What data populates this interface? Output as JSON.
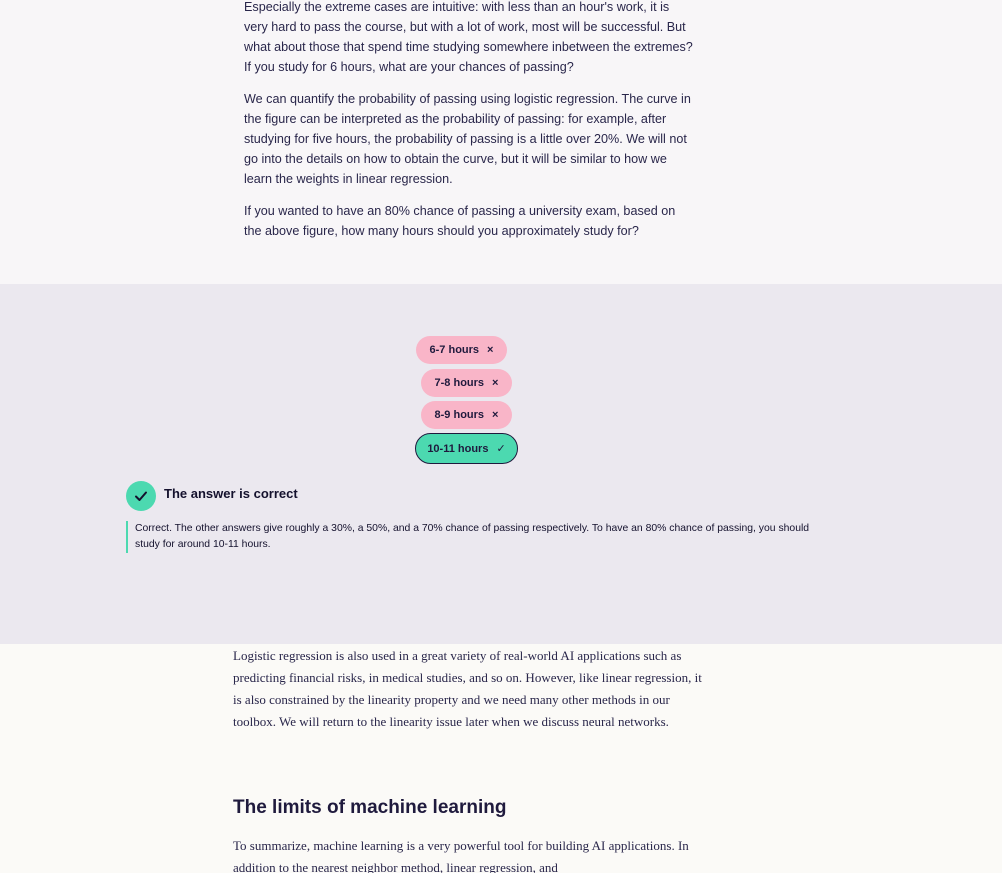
{
  "intro": {
    "paragraphs": [
      "Especially the extreme cases are intuitive: with less than an hour's work, it is very hard to pass the course, but with a lot of work, most will be successful. But what about those that spend time studying somewhere inbetween the extremes? If you study for 6 hours, what are your chances of passing?",
      "We can quantify the probability of passing using logistic regression. The curve in the figure can be interpreted as the probability of passing: for example, after studying for five hours, the probability of passing is a little over 20%. We will not go into the details on how to obtain the curve, but it will be similar to how we learn the weights in linear regression.",
      "If you wanted to have an 80% chance of passing a university exam, based on the above figure, how many hours should you approximately study for?"
    ]
  },
  "quiz": {
    "options": [
      {
        "label": "6-7 hours",
        "status": "wrong",
        "mark": "×"
      },
      {
        "label": "7-8 hours",
        "status": "wrong",
        "mark": "×"
      },
      {
        "label": "8-9 hours",
        "status": "wrong",
        "mark": "×"
      },
      {
        "label": "10-11 hours",
        "status": "correct",
        "mark": "✓"
      }
    ],
    "result_title": "The answer is correct",
    "feedback": "Correct. The other answers give roughly a 30%, a 50%, and a 70% chance of passing respectively. To have an 80% chance of passing, you should study for around 10-11 hours.",
    "colors": {
      "correct": "#4cd9b0",
      "wrong": "#f9b5c8",
      "accent": "#3ccf9c"
    }
  },
  "content": {
    "paragraph_1": "Logistic regression is also used in a great variety of real-world AI applications such as predicting financial risks, in medical studies, and so on. However, like linear regression, it is also constrained by the linearity property and we need many other methods in our toolbox. We will return to the linearity issue later when we discuss neural networks.",
    "heading": "The limits of machine learning",
    "paragraph_2": "To summarize, machine learning is a very powerful tool for building AI applications. In addition to the nearest neighbor method, linear regression, and"
  }
}
